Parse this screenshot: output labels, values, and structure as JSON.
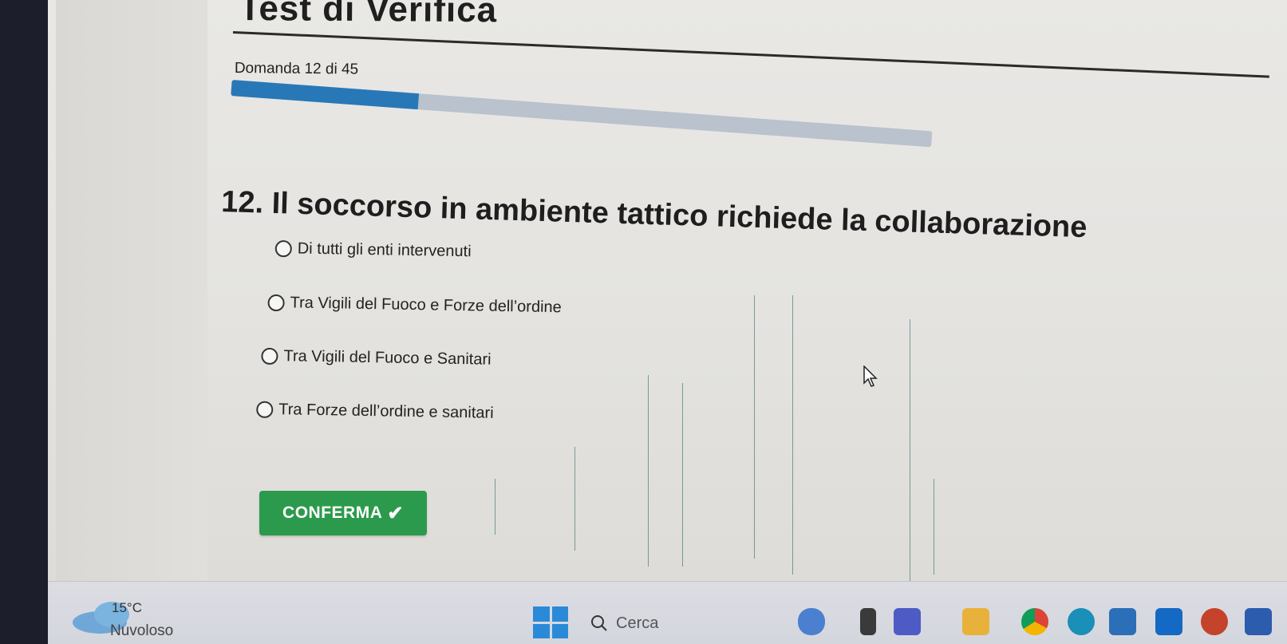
{
  "page": {
    "title": "Test di Verifica",
    "counter": "Domanda 12 di 45",
    "progress_percent": 26.7
  },
  "question": {
    "text": "12. Il soccorso in ambiente tattico richiede la collaborazione",
    "options": [
      "Di tutti gli enti intervenuti",
      "Tra Vigili del Fuoco e Forze dell’ordine",
      "Tra Vigili del Fuoco e Sanitari",
      "Tra Forze dell’ordine e sanitari"
    ]
  },
  "confirm": {
    "label": "CONFERMA",
    "icon": "check-icon"
  },
  "taskbar": {
    "weather_temp": "15°C",
    "weather_label": "Nuvoloso",
    "search_placeholder": "Cerca",
    "icons": [
      "windows-icon",
      "search-icon",
      "game-icon",
      "file-explorer-icon",
      "teams-icon",
      "folder-icon",
      "chrome-icon",
      "edge-icon",
      "store-icon",
      "outlook-icon",
      "powerpoint-icon",
      "word-icon"
    ]
  }
}
